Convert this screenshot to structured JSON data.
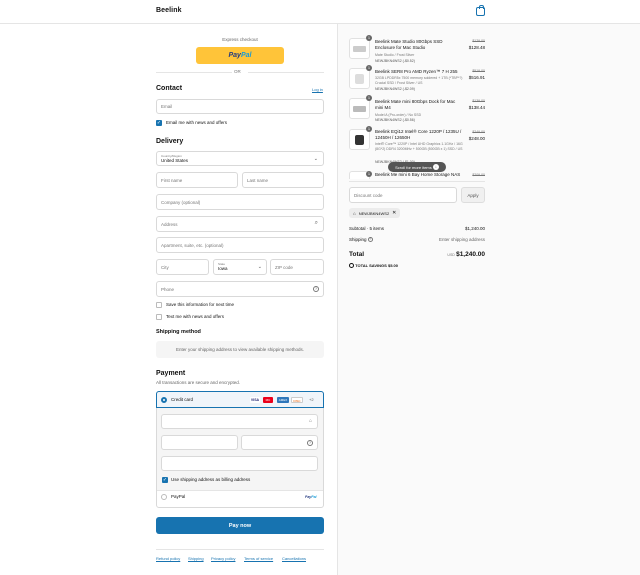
{
  "header": {
    "brand": "Beelink"
  },
  "express": {
    "title": "Express checkout",
    "paypal_pay": "Pay",
    "paypal_pal": "Pal",
    "or": "OR"
  },
  "contact": {
    "title": "Contact",
    "login": "Log in",
    "email_placeholder": "Email",
    "email_offers": "Email me with news and offers"
  },
  "delivery": {
    "title": "Delivery",
    "country_label": "Country/Region",
    "country_value": "United States",
    "first_name": "First name",
    "last_name": "Last name",
    "company": "Company (optional)",
    "address": "Address",
    "apartment": "Apartment, suite, etc. (optional)",
    "city": "City",
    "state_label": "State",
    "state_value": "Iowa",
    "zip": "ZIP code",
    "phone": "Phone",
    "save_info": "Save this information for next time",
    "text_offers": "Text me with news and offers"
  },
  "shipping": {
    "title": "Shipping method",
    "message": "Enter your shipping address to view available shipping methods."
  },
  "payment": {
    "title": "Payment",
    "subtitle": "All transactions are secure and encrypted.",
    "credit_card": "Credit card",
    "card_logos": [
      "VISA",
      "MC",
      "AMEX",
      "DISC"
    ],
    "more_cards": "+2",
    "use_shipping": "Use shipping address as billing address",
    "paypal": "PayPal",
    "pay_now": "Pay now"
  },
  "footer": {
    "links": [
      "Refund policy",
      "Shipping",
      "Privacy policy",
      "Terms of service",
      "Cancellations"
    ]
  },
  "cart": {
    "items": [
      {
        "qty": "1",
        "name": "Beelink Mate Studio 80Gbps SSD Enclosure for Mac Studio",
        "variant": "Mate Studio / Frost Silver",
        "discount": "NEWJBKN4WS2 (-$0.52)",
        "old_price": "$129.00",
        "price": "$128.48"
      },
      {
        "qty": "1",
        "name": "Beelink SER8 Pro AMD Ryzen™ 7 H 255",
        "variant": "32GB LPDDR5x 7500 memory soldered + 1TB (*TBP*?) Crucial SSD / Frost Silver / US",
        "discount": "NEWJBKN4WS2 (-$2.09)",
        "old_price": "$519.00",
        "price": "$516.91"
      },
      {
        "qty": "1",
        "name": "Beelink Mate mini 80Gbps Dock for Mac mini M4",
        "variant": "Model A (Pro-order) / No SSD",
        "discount": "NEWJBKN4WS2 (-$0.56)",
        "old_price": "$139.00",
        "price": "$138.44"
      },
      {
        "qty": "1",
        "name": "Beelink EQi12 Intel® Core 1220P / 1235U / 12450H / 12650H",
        "variant": "Intel® Core™ 1220P / Intel UHD Graphics 1.1GHz / 16G (8G*2) DDR4 3200MHz + 500GB (500GB x 1) SSD / US",
        "discount": "NEWJBKN4WS2 (-$1.00)",
        "old_price": "$249.00",
        "price": "$248.00"
      },
      {
        "qty": "1",
        "name": "Beelink Me mini 6 Bay Home Storage NAS",
        "variant": "",
        "discount": "",
        "old_price": "$209.00",
        "price": ""
      }
    ],
    "scroll_tooltip": "Scroll for more items",
    "discount_placeholder": "Discount code",
    "apply": "Apply",
    "applied_code": "NEWJBKN4WS2",
    "subtotal_label": "Subtotal · 5 items",
    "subtotal_value": "$1,240.00",
    "shipping_label": "Shipping",
    "shipping_value": "Enter shipping address",
    "total_label": "Total",
    "currency": "USD",
    "total_value": "$1,240.00",
    "savings_label": "TOTAL SAVINGS",
    "savings_value": "$5.00"
  }
}
